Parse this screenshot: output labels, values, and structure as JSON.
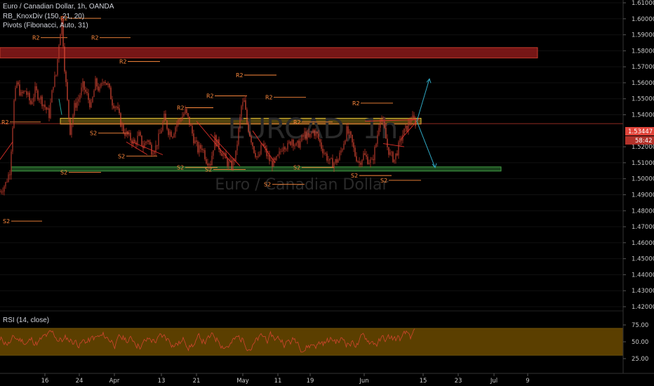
{
  "legend": {
    "symbol": "Euro / Canadian Dollar, 1h, OANDA",
    "indicator_1": "RB_KnoxDiv (150, 21, 20)",
    "indicator_2": "Pivots (Fibonacci, Auto, 31)"
  },
  "watermark": {
    "ticker": "EURCAD, 1h",
    "name": "Euro / Canadian Dollar"
  },
  "rsi_panel": {
    "label": "RSI (14, close)"
  },
  "price_badge": {
    "value": "1.53447",
    "countdown": "58:42"
  },
  "colors": {
    "candles": "#d23a2a",
    "pivot": "#ff8a3d",
    "resistance_zone": "#8b1a1a",
    "yellow_zone": "#e5c43a",
    "support_zone": "#2e7d32",
    "arrow": "#2fa7c2",
    "rsi_band": "#6b4a00",
    "badge": "#e0443a"
  },
  "chart_data": [
    {
      "type": "candlestick",
      "title": "Euro / Canadian Dollar, 1h, OANDA",
      "price_ticks": [
        "1.61000",
        "1.60000",
        "1.59000",
        "1.58000",
        "1.57000",
        "1.56000",
        "1.55000",
        "1.54000",
        "1.52000",
        "1.51000",
        "1.50000",
        "1.49000",
        "1.48000",
        "1.47000",
        "1.46000",
        "1.45000",
        "1.44000",
        "1.43000",
        "1.42000"
      ],
      "date_ticks": [
        "16",
        "24",
        "Apr",
        "13",
        "21",
        "May",
        "11",
        "19",
        "Jun",
        "15",
        "23",
        "Jul",
        "9"
      ],
      "ylim": [
        1.418,
        1.615
      ],
      "close_path": {
        "x": [
          0,
          8,
          14,
          20,
          24,
          30,
          36,
          44,
          50,
          58,
          64,
          70,
          76,
          80,
          84,
          88,
          92,
          96,
          100,
          106,
          112,
          118,
          124,
          130,
          136,
          142,
          148,
          154,
          160,
          166,
          172,
          176,
          180,
          186,
          192,
          198,
          204,
          210,
          216,
          222,
          228,
          234,
          240,
          246,
          252,
          258,
          264,
          270,
          276,
          282,
          288,
          294,
          300,
          306,
          312,
          318,
          324,
          330,
          336,
          340,
          344,
          348,
          352,
          356,
          362,
          368,
          374,
          380,
          386,
          392,
          398,
          404,
          410,
          416,
          422,
          428,
          434,
          440,
          446,
          452,
          458,
          464,
          470,
          476,
          482,
          488,
          494,
          500,
          506,
          512,
          518,
          524,
          530,
          536,
          542,
          548,
          552,
          556,
          562,
          568,
          574,
          580,
          586,
          592
        ],
        "y": [
          1.492,
          1.497,
          1.505,
          1.548,
          1.56,
          1.552,
          1.555,
          1.547,
          1.555,
          1.55,
          1.545,
          1.54,
          1.56,
          1.565,
          1.585,
          1.6,
          1.57,
          1.548,
          1.53,
          1.545,
          1.55,
          1.558,
          1.552,
          1.545,
          1.56,
          1.555,
          1.563,
          1.558,
          1.548,
          1.545,
          1.535,
          1.53,
          1.528,
          1.525,
          1.522,
          1.527,
          1.52,
          1.525,
          1.518,
          1.52,
          1.528,
          1.538,
          1.53,
          1.528,
          1.535,
          1.538,
          1.542,
          1.535,
          1.525,
          1.518,
          1.52,
          1.512,
          1.51,
          1.525,
          1.52,
          1.515,
          1.51,
          1.508,
          1.515,
          1.53,
          1.545,
          1.548,
          1.535,
          1.528,
          1.518,
          1.512,
          1.522,
          1.515,
          1.51,
          1.51,
          1.515,
          1.522,
          1.52,
          1.525,
          1.52,
          1.523,
          1.528,
          1.525,
          1.53,
          1.527,
          1.52,
          1.515,
          1.51,
          1.51,
          1.512,
          1.52,
          1.53,
          1.525,
          1.515,
          1.51,
          1.515,
          1.512,
          1.51,
          1.522,
          1.54,
          1.53,
          1.52,
          1.515,
          1.512,
          1.52,
          1.528,
          1.532,
          1.538,
          1.535
        ]
      },
      "pivot_levels": [
        {
          "label": "R2",
          "price": 1.6003,
          "x1": 90,
          "x2": 144
        },
        {
          "label": "R2",
          "price": 1.5882,
          "x1": 50,
          "x2": 96
        },
        {
          "label": "R2",
          "price": 1.5882,
          "x1": 134,
          "x2": 186
        },
        {
          "label": "R2",
          "price": 1.5733,
          "x1": 174,
          "x2": 228
        },
        {
          "label": "R2",
          "price": 1.5648,
          "x1": 340,
          "x2": 394
        },
        {
          "label": "R2",
          "price": 1.5518,
          "x1": 298,
          "x2": 352
        },
        {
          "label": "R2",
          "price": 1.5509,
          "x1": 382,
          "x2": 436
        },
        {
          "label": "R2",
          "price": 1.5473,
          "x1": 506,
          "x2": 560
        },
        {
          "label": "R2",
          "price": 1.5444,
          "x1": 256,
          "x2": 304
        },
        {
          "label": "R2",
          "price": 1.5355,
          "x1": 6,
          "x2": 58
        },
        {
          "label": "R2",
          "price": 1.5355,
          "x1": 422,
          "x2": 474
        },
        {
          "label": "S2",
          "price": 1.5285,
          "x1": 132,
          "x2": 184
        },
        {
          "label": "S2",
          "price": 1.5142,
          "x1": 172,
          "x2": 224
        },
        {
          "label": "S2",
          "price": 1.507,
          "x1": 256,
          "x2": 310
        },
        {
          "label": "S2",
          "price": 1.507,
          "x1": 422,
          "x2": 476
        },
        {
          "label": "S2",
          "price": 1.5058,
          "x1": 296,
          "x2": 350
        },
        {
          "label": "S2",
          "price": 1.504,
          "x1": 90,
          "x2": 144
        },
        {
          "label": "S2",
          "price": 1.502,
          "x1": 504,
          "x2": 558
        },
        {
          "label": "S2",
          "price": 1.499,
          "x1": 546,
          "x2": 600
        },
        {
          "label": "S2",
          "price": 1.4965,
          "x1": 380,
          "x2": 434
        },
        {
          "label": "S2",
          "price": 1.4735,
          "x1": 8,
          "x2": 60
        }
      ],
      "zones": [
        {
          "name": "resistance",
          "top": 1.582,
          "bottom": 1.5755
        },
        {
          "name": "yellow",
          "top": 1.5378,
          "bottom": 1.5342
        },
        {
          "name": "support",
          "top": 1.5074,
          "bottom": 1.5048
        }
      ],
      "current_price": 1.53447
    },
    {
      "type": "line",
      "title": "RSI (14, close)",
      "ticks": [
        "75.00",
        "50.00",
        "25.00"
      ],
      "ylim": [
        5,
        95
      ],
      "band": [
        30,
        70
      ]
    }
  ]
}
